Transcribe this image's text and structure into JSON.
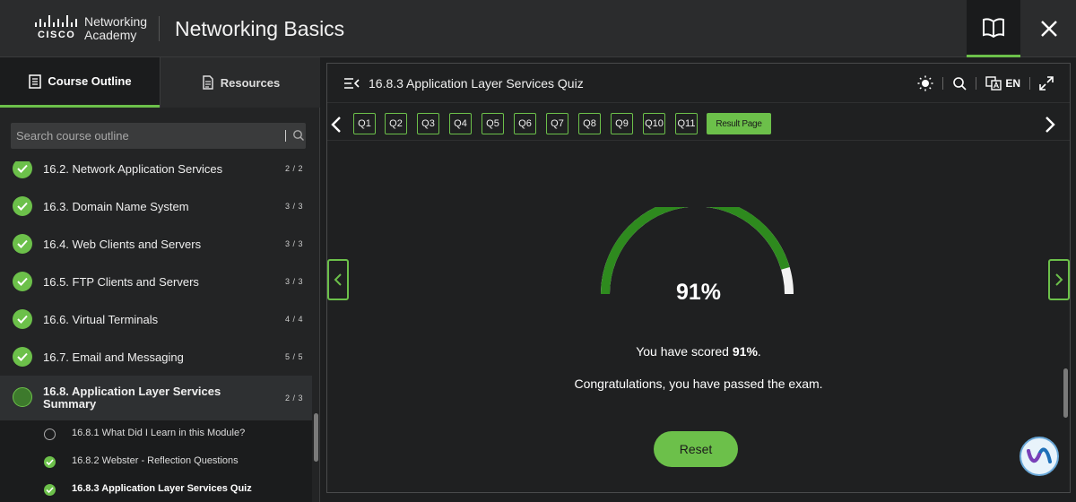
{
  "header": {
    "logo": {
      "brand": "CISCO",
      "line1": "Networking",
      "line2": "Academy"
    },
    "title": "Networking Basics",
    "book_icon": "book-icon",
    "close_icon": "close-icon"
  },
  "sidebar": {
    "tabs": [
      {
        "label": "Course Outline",
        "icon": "outline-icon",
        "active": true
      },
      {
        "label": "Resources",
        "icon": "document-icon",
        "active": false
      }
    ],
    "search": {
      "placeholder": "Search course outline"
    },
    "items": [
      {
        "label": "16.2. Network Application Services",
        "count": "2 / 2",
        "status": "complete"
      },
      {
        "label": "16.3. Domain Name System",
        "count": "3 / 3",
        "status": "complete"
      },
      {
        "label": "16.4. Web Clients and Servers",
        "count": "3 / 3",
        "status": "complete"
      },
      {
        "label": "16.5. FTP Clients and Servers",
        "count": "3 / 3",
        "status": "complete"
      },
      {
        "label": "16.6. Virtual Terminals",
        "count": "4 / 4",
        "status": "complete"
      },
      {
        "label": "16.7. Email and Messaging",
        "count": "5 / 5",
        "status": "complete"
      },
      {
        "label": "16.8. Application Layer Services Summary",
        "count": "2 / 3",
        "status": "in-progress"
      }
    ],
    "subitems": [
      {
        "label": "16.8.1 What Did I Learn in this Module?",
        "status": "incomplete"
      },
      {
        "label": "16.8.2 Webster - Reflection Questions",
        "status": "complete"
      },
      {
        "label": "16.8.3 Application Layer Services Quiz",
        "status": "current"
      }
    ]
  },
  "main": {
    "title": "16.8.3 Application Layer Services Quiz",
    "language": "EN",
    "questions": [
      "Q1",
      "Q2",
      "Q3",
      "Q4",
      "Q5",
      "Q6",
      "Q7",
      "Q8",
      "Q9",
      "Q10",
      "Q11"
    ],
    "result_page_label": "Result Page",
    "score_fraction": 0.91,
    "score_text": "91%",
    "scored_prefix": "You have scored ",
    "scored_value": "91%",
    "scored_suffix": ".",
    "congrats": "Congratulations, you have passed the exam.",
    "reset_label": "Reset"
  },
  "colors": {
    "accent": "#6cc04a",
    "background": "#1f2021",
    "panel": "#232425"
  }
}
